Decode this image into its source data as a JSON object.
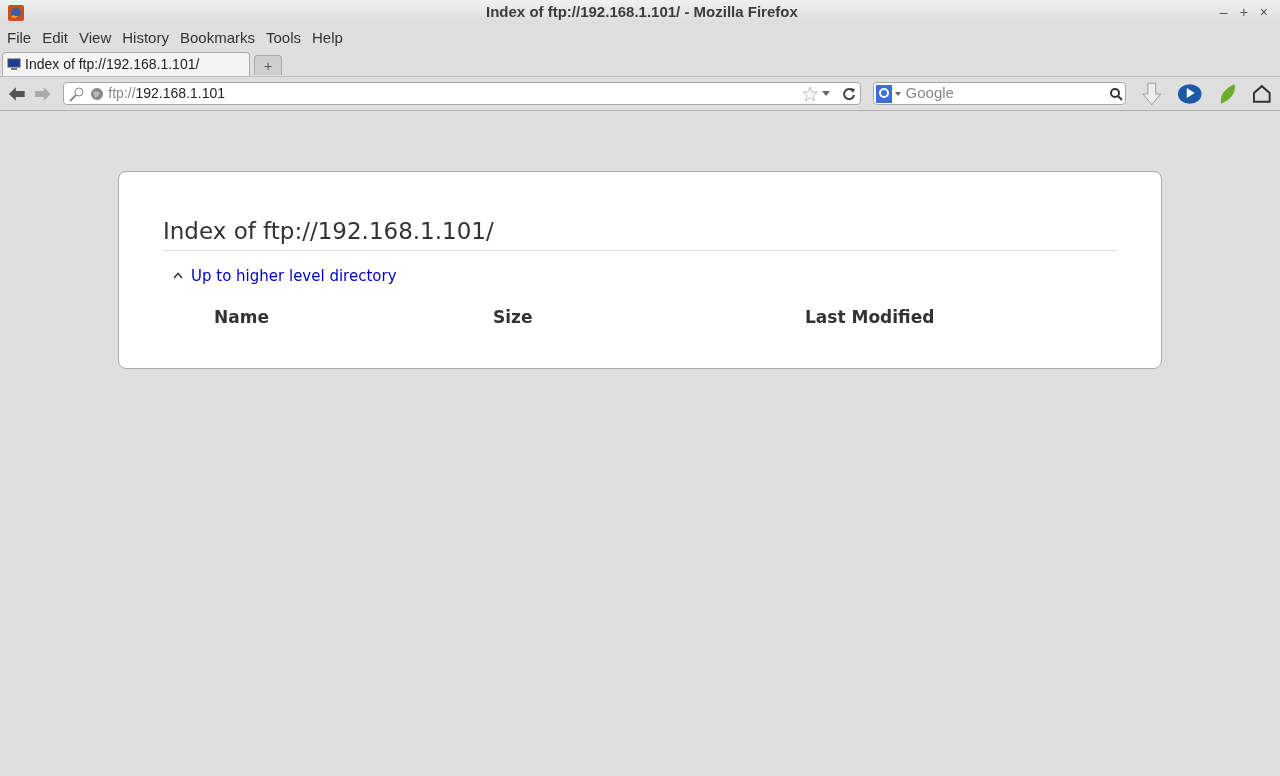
{
  "window": {
    "title": "Index of ftp://192.168.1.101/ - Mozilla Firefox",
    "controls": [
      "–",
      "+",
      "×"
    ]
  },
  "menu": [
    "File",
    "Edit",
    "View",
    "History",
    "Bookmarks",
    "Tools",
    "Help"
  ],
  "tabs": [
    {
      "label": "Index of ftp://192.168.1.101/",
      "selected": true
    }
  ],
  "new_tab": "+",
  "address": {
    "scheme": "ftp://",
    "host": "192.168.1.101"
  },
  "search": {
    "placeholder": "Google"
  },
  "page": {
    "heading": "Index of ftp://192.168.1.101/",
    "up_link": "Up to higher level directory",
    "columns": [
      "Name",
      "Size",
      "Last Modified"
    ]
  }
}
